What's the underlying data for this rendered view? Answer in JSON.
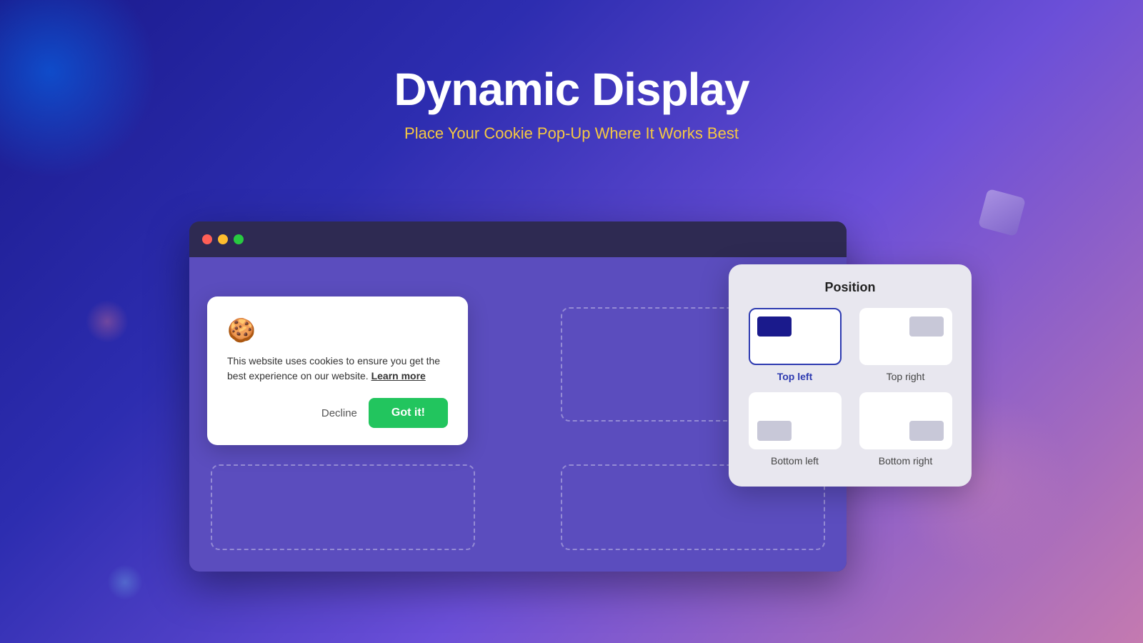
{
  "header": {
    "title": "Dynamic Display",
    "subtitle": "Place Your Cookie Pop-Up Where It Works Best"
  },
  "browser": {
    "dots": [
      "red",
      "yellow",
      "green"
    ]
  },
  "cookie_popup": {
    "icon": "🍪",
    "text": "This website uses cookies to ensure you get the best experience on our website.",
    "learn_more": "Learn more",
    "decline_label": "Decline",
    "got_it_label": "Got it!"
  },
  "position_panel": {
    "title": "Position",
    "options": [
      {
        "id": "top-left",
        "label": "Top left",
        "selected": true
      },
      {
        "id": "top-right",
        "label": "Top right",
        "selected": false
      },
      {
        "id": "bottom-left",
        "label": "Bottom left",
        "selected": false
      },
      {
        "id": "bottom-right",
        "label": "Bottom right",
        "selected": false
      }
    ]
  }
}
